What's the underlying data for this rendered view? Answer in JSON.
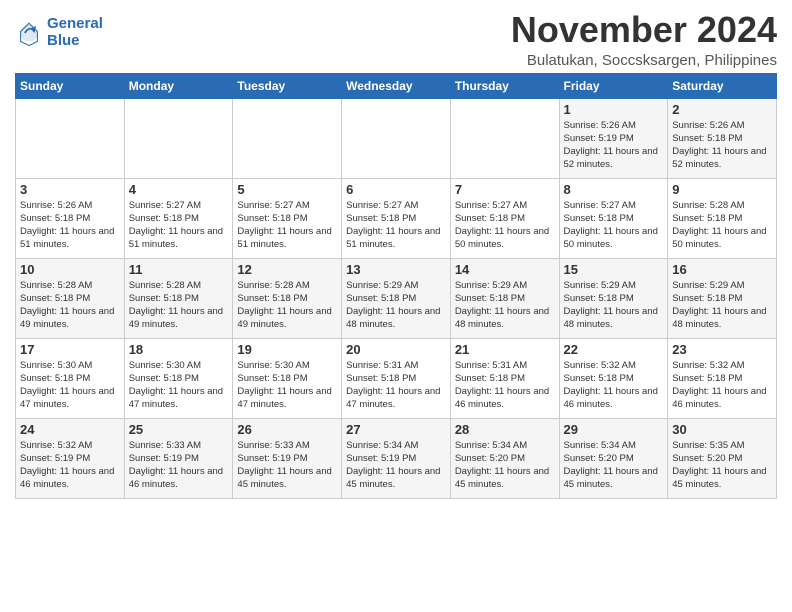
{
  "header": {
    "logo_line1": "General",
    "logo_line2": "Blue",
    "month": "November 2024",
    "location": "Bulatukan, Soccsksargen, Philippines"
  },
  "weekdays": [
    "Sunday",
    "Monday",
    "Tuesday",
    "Wednesday",
    "Thursday",
    "Friday",
    "Saturday"
  ],
  "weeks": [
    [
      {
        "day": "",
        "content": ""
      },
      {
        "day": "",
        "content": ""
      },
      {
        "day": "",
        "content": ""
      },
      {
        "day": "",
        "content": ""
      },
      {
        "day": "",
        "content": ""
      },
      {
        "day": "1",
        "content": "Sunrise: 5:26 AM\nSunset: 5:19 PM\nDaylight: 11 hours and 52 minutes."
      },
      {
        "day": "2",
        "content": "Sunrise: 5:26 AM\nSunset: 5:18 PM\nDaylight: 11 hours and 52 minutes."
      }
    ],
    [
      {
        "day": "3",
        "content": "Sunrise: 5:26 AM\nSunset: 5:18 PM\nDaylight: 11 hours and 51 minutes."
      },
      {
        "day": "4",
        "content": "Sunrise: 5:27 AM\nSunset: 5:18 PM\nDaylight: 11 hours and 51 minutes."
      },
      {
        "day": "5",
        "content": "Sunrise: 5:27 AM\nSunset: 5:18 PM\nDaylight: 11 hours and 51 minutes."
      },
      {
        "day": "6",
        "content": "Sunrise: 5:27 AM\nSunset: 5:18 PM\nDaylight: 11 hours and 51 minutes."
      },
      {
        "day": "7",
        "content": "Sunrise: 5:27 AM\nSunset: 5:18 PM\nDaylight: 11 hours and 50 minutes."
      },
      {
        "day": "8",
        "content": "Sunrise: 5:27 AM\nSunset: 5:18 PM\nDaylight: 11 hours and 50 minutes."
      },
      {
        "day": "9",
        "content": "Sunrise: 5:28 AM\nSunset: 5:18 PM\nDaylight: 11 hours and 50 minutes."
      }
    ],
    [
      {
        "day": "10",
        "content": "Sunrise: 5:28 AM\nSunset: 5:18 PM\nDaylight: 11 hours and 49 minutes."
      },
      {
        "day": "11",
        "content": "Sunrise: 5:28 AM\nSunset: 5:18 PM\nDaylight: 11 hours and 49 minutes."
      },
      {
        "day": "12",
        "content": "Sunrise: 5:28 AM\nSunset: 5:18 PM\nDaylight: 11 hours and 49 minutes."
      },
      {
        "day": "13",
        "content": "Sunrise: 5:29 AM\nSunset: 5:18 PM\nDaylight: 11 hours and 48 minutes."
      },
      {
        "day": "14",
        "content": "Sunrise: 5:29 AM\nSunset: 5:18 PM\nDaylight: 11 hours and 48 minutes."
      },
      {
        "day": "15",
        "content": "Sunrise: 5:29 AM\nSunset: 5:18 PM\nDaylight: 11 hours and 48 minutes."
      },
      {
        "day": "16",
        "content": "Sunrise: 5:29 AM\nSunset: 5:18 PM\nDaylight: 11 hours and 48 minutes."
      }
    ],
    [
      {
        "day": "17",
        "content": "Sunrise: 5:30 AM\nSunset: 5:18 PM\nDaylight: 11 hours and 47 minutes."
      },
      {
        "day": "18",
        "content": "Sunrise: 5:30 AM\nSunset: 5:18 PM\nDaylight: 11 hours and 47 minutes."
      },
      {
        "day": "19",
        "content": "Sunrise: 5:30 AM\nSunset: 5:18 PM\nDaylight: 11 hours and 47 minutes."
      },
      {
        "day": "20",
        "content": "Sunrise: 5:31 AM\nSunset: 5:18 PM\nDaylight: 11 hours and 47 minutes."
      },
      {
        "day": "21",
        "content": "Sunrise: 5:31 AM\nSunset: 5:18 PM\nDaylight: 11 hours and 46 minutes."
      },
      {
        "day": "22",
        "content": "Sunrise: 5:32 AM\nSunset: 5:18 PM\nDaylight: 11 hours and 46 minutes."
      },
      {
        "day": "23",
        "content": "Sunrise: 5:32 AM\nSunset: 5:18 PM\nDaylight: 11 hours and 46 minutes."
      }
    ],
    [
      {
        "day": "24",
        "content": "Sunrise: 5:32 AM\nSunset: 5:19 PM\nDaylight: 11 hours and 46 minutes."
      },
      {
        "day": "25",
        "content": "Sunrise: 5:33 AM\nSunset: 5:19 PM\nDaylight: 11 hours and 46 minutes."
      },
      {
        "day": "26",
        "content": "Sunrise: 5:33 AM\nSunset: 5:19 PM\nDaylight: 11 hours and 45 minutes."
      },
      {
        "day": "27",
        "content": "Sunrise: 5:34 AM\nSunset: 5:19 PM\nDaylight: 11 hours and 45 minutes."
      },
      {
        "day": "28",
        "content": "Sunrise: 5:34 AM\nSunset: 5:20 PM\nDaylight: 11 hours and 45 minutes."
      },
      {
        "day": "29",
        "content": "Sunrise: 5:34 AM\nSunset: 5:20 PM\nDaylight: 11 hours and 45 minutes."
      },
      {
        "day": "30",
        "content": "Sunrise: 5:35 AM\nSunset: 5:20 PM\nDaylight: 11 hours and 45 minutes."
      }
    ]
  ]
}
